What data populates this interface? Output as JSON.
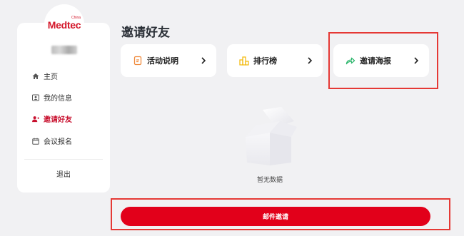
{
  "brand": {
    "logo_text": "Medtec",
    "logo_sup": "China"
  },
  "sidebar": {
    "items": [
      {
        "label": "主页",
        "icon": "home-icon",
        "active": false
      },
      {
        "label": "我的信息",
        "icon": "user-card-icon",
        "active": false
      },
      {
        "label": "邀请好友",
        "icon": "invite-friends-icon",
        "active": true
      },
      {
        "label": "会议报名",
        "icon": "calendar-icon",
        "active": false
      }
    ],
    "logout_label": "退出"
  },
  "main": {
    "title": "邀请好友",
    "cards": [
      {
        "label": "活动说明",
        "icon": "activity-notes-icon"
      },
      {
        "label": "排行榜",
        "icon": "ranking-icon"
      },
      {
        "label": "邀请海报",
        "icon": "share-arrow-icon"
      }
    ],
    "empty_text": "暂无数据",
    "mail_button_label": "邮件邀请"
  },
  "colors": {
    "accent": "#e2001a",
    "highlight": "#e53935",
    "active_nav": "#c8102e",
    "background": "#f1f1f3"
  }
}
